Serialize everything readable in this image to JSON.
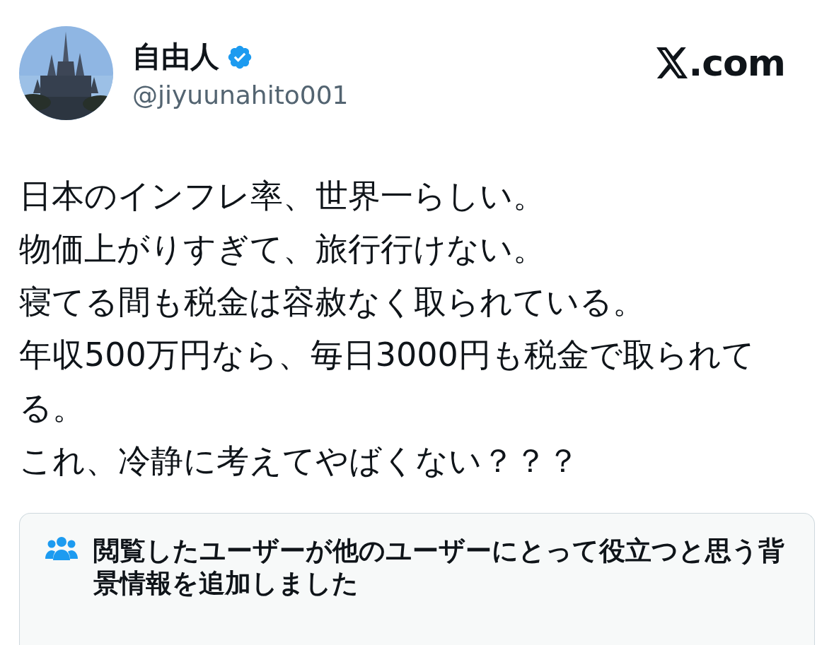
{
  "author": {
    "name": "自由人",
    "verified": true,
    "handle": "@jiyuunahito001"
  },
  "brand": {
    "suffix": ".com"
  },
  "post": {
    "lines": [
      "日本のインフレ率、世界一らしい。",
      "物価上がりすぎて、旅行行けない。",
      "寝てる間も税金は容赦なく取られている。",
      "年収500万円なら、毎日3000円も税金で取られてる。",
      "これ、冷静に考えてやばくない？？？"
    ]
  },
  "note": {
    "title": "閲覧したユーザーが他のユーザーにとって役立つと思う背景情報を追加しました"
  }
}
